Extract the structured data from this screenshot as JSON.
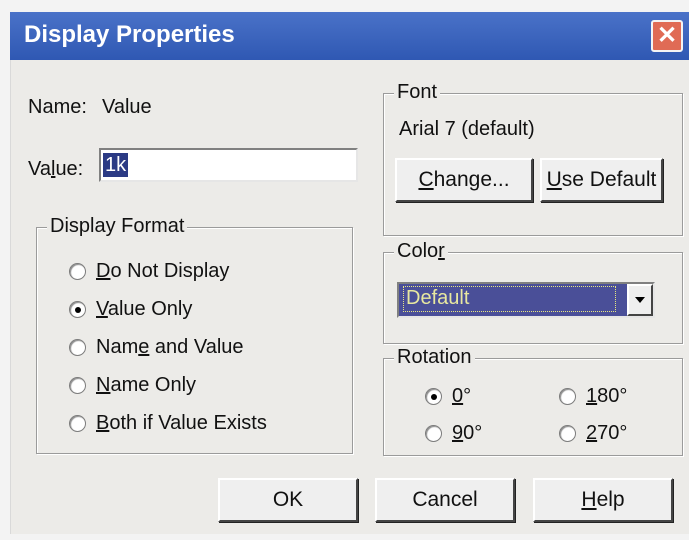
{
  "window": {
    "title": "Display Properties",
    "close_glyph": "✕"
  },
  "name_row": {
    "label": "Name:",
    "value": "Value"
  },
  "value_row": {
    "label_prefix": "Va",
    "label_mnemonic": "l",
    "label_suffix": "ue:",
    "input_value": "1k"
  },
  "display_format": {
    "legend": "Display Format",
    "options": [
      {
        "pre": "",
        "mn": "D",
        "post": "o Not Display",
        "checked": false
      },
      {
        "pre": "",
        "mn": "V",
        "post": "alue Only",
        "checked": true
      },
      {
        "pre": "Nam",
        "mn": "e",
        "post": " and Value",
        "checked": false
      },
      {
        "pre": "",
        "mn": "N",
        "post": "ame Only",
        "checked": false
      },
      {
        "pre": "",
        "mn": "B",
        "post": "oth if Value Exists",
        "checked": false
      }
    ]
  },
  "font": {
    "legend": "Font",
    "value": "Arial 7 (default)",
    "change_pre": "",
    "change_mn": "C",
    "change_post": "hange...",
    "default_pre": "",
    "default_mn": "U",
    "default_post": "se Default"
  },
  "color": {
    "legend_pre": "Colo",
    "legend_mn": "r",
    "legend_post": "",
    "selected": "Default",
    "dropdown_icon": "chevron-down-icon"
  },
  "rotation": {
    "legend": "Rotation",
    "options": [
      {
        "mn": "0",
        "post": "°",
        "checked": true
      },
      {
        "mn": "1",
        "post": "80°",
        "checked": false
      },
      {
        "mn": "9",
        "post": "0°",
        "checked": false
      },
      {
        "mn": "2",
        "post": "70°",
        "checked": false
      }
    ]
  },
  "buttons": {
    "ok": "OK",
    "cancel": "Cancel",
    "help_mn": "H",
    "help_post": "elp"
  }
}
